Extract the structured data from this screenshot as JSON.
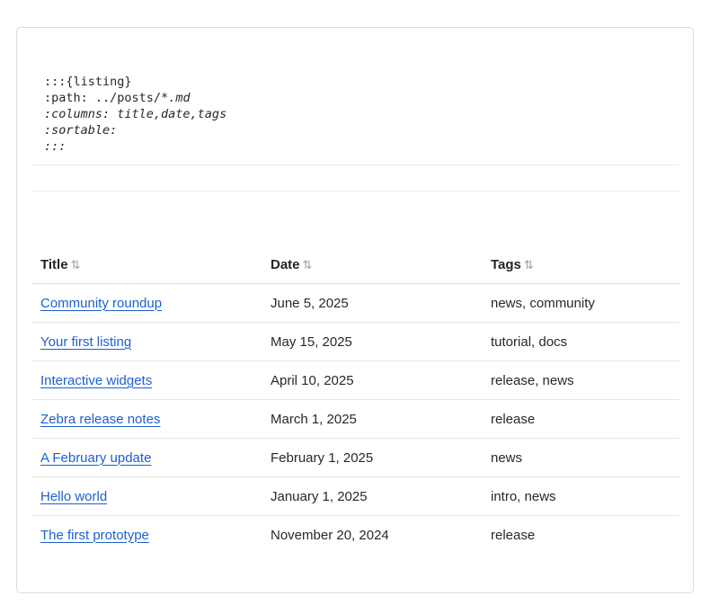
{
  "code": {
    "line1": ":::{listing}",
    "line2_key": ":path: ",
    "line2_val": "../posts/*",
    "line2_ext": ".md",
    "line3": ":columns: title,date,tags",
    "line4": ":sortable:",
    "line5": ":::"
  },
  "table": {
    "headers": [
      {
        "label": "Title",
        "sort_icon": "⇅"
      },
      {
        "label": "Date",
        "sort_icon": "⇅"
      },
      {
        "label": "Tags",
        "sort_icon": "⇅"
      }
    ],
    "rows": [
      {
        "title": "Community roundup",
        "date": "June 5, 2025",
        "tags": "news, community"
      },
      {
        "title": "Your first listing",
        "date": "May 15, 2025",
        "tags": "tutorial, docs"
      },
      {
        "title": "Interactive widgets",
        "date": "April 10, 2025",
        "tags": "release, news"
      },
      {
        "title": "Zebra release notes",
        "date": "March 1, 2025",
        "tags": "release"
      },
      {
        "title": "A February update",
        "date": "February 1, 2025",
        "tags": "news"
      },
      {
        "title": "Hello world",
        "date": "January 1, 2025",
        "tags": "intro, news"
      },
      {
        "title": "The first prototype",
        "date": "November 20, 2024",
        "tags": "release"
      }
    ]
  },
  "colors": {
    "link": "#1d5fd1",
    "border": "#dcdcdc",
    "sort_icon": "#9aa0a6"
  }
}
